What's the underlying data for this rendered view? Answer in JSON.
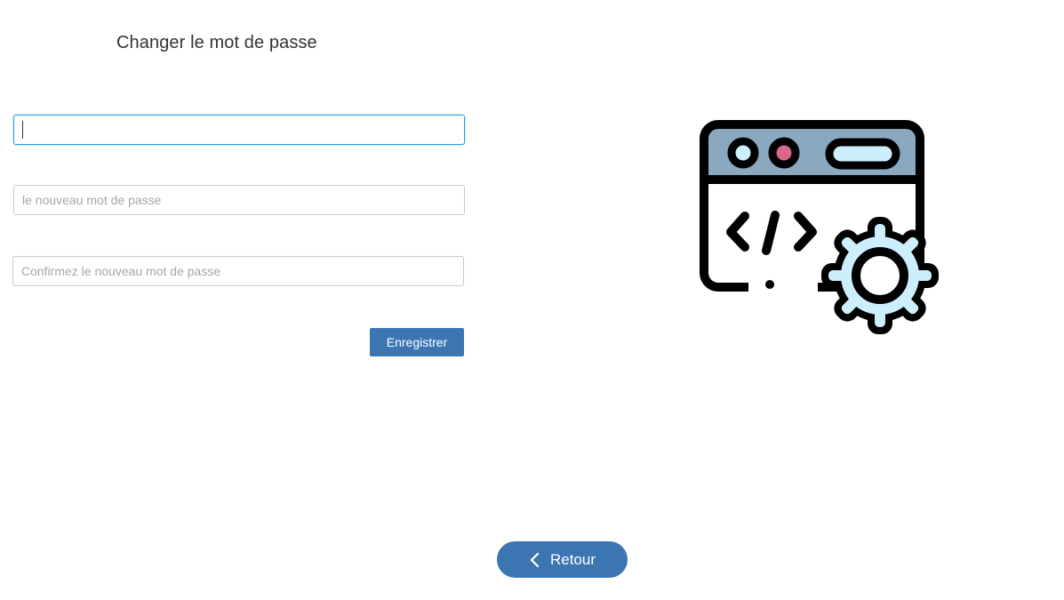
{
  "form": {
    "title": "Changer le mot de passe",
    "current_password_value": "",
    "new_password_placeholder": "le nouveau mot de passe",
    "confirm_password_placeholder": "Confirmez le nouveau mot de passe",
    "save_label": "Enregistrer"
  },
  "navigation": {
    "back_label": "Retour",
    "back_icon": "chevron-left-icon"
  },
  "illustration": {
    "icon": "web-development-settings-icon",
    "code_symbol": "</>"
  },
  "colors": {
    "primary_button": "#3b75b2",
    "focus_border": "#29a3d6",
    "browser_header": "#8aa8c0",
    "dot_accent": "#d9668c",
    "light_blue": "#cdeffb",
    "title_text": "#333333"
  }
}
